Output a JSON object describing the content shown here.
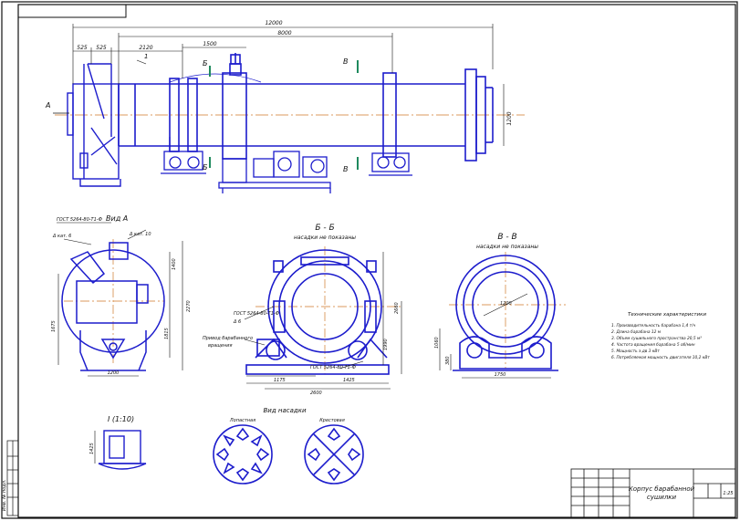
{
  "colors": {
    "blue": "#1c1ccc",
    "black": "#111111",
    "center": "#d07a2a",
    "green": "#1f8a5e"
  },
  "dims_top": {
    "overall": "12000",
    "d1": "8000",
    "d2": "1500",
    "d3": "2120",
    "d4": "525",
    "d5": "525",
    "diam": "1200"
  },
  "section_marks": {
    "a": "А",
    "b1": "Б",
    "b2": "Б",
    "v1": "В",
    "v2": "В",
    "one": "1"
  },
  "view_a": {
    "title": "Вид А",
    "gost": "ГОСТ 5264-80-T1-Ф",
    "weld_left": "Δ кат. 6",
    "weld_right": "Δ кат. 10",
    "h1": "1400",
    "h2": "2270",
    "h3": "1815",
    "w": "1200",
    "left_h": "1675"
  },
  "section_bb": {
    "title": "Б - Б",
    "subtitle": "насадки не показаны",
    "gost1": "ГОСТ 5264-80-T1-Ф",
    "gost2": "ГОСТ 5264-80-T1-Ф",
    "weld": "Δ 6",
    "note1": "Привод барабанного",
    "note2": "вращения",
    "d1": "1175",
    "d2": "1425",
    "d3": "2600",
    "h": "2660",
    "hh": "1990"
  },
  "section_vv": {
    "title": "В - В",
    "subtitle": "насадки не показаны",
    "dia": "1200",
    "w": "1750",
    "h1": "1060",
    "h2": "380"
  },
  "detail_1": {
    "title": "I (1:10)",
    "dim": "1425"
  },
  "nozzles": {
    "title": "Вид насадки",
    "left": "Лопастная",
    "right": "Крестовая"
  },
  "tech": {
    "title": "Технические характеристики",
    "lines": [
      "1. Производительность барабана 1,4 т/ч",
      "2. Длина барабана 12 м",
      "3. Объем сушильного пространства 20,5 м³",
      "4. Частота вращения барабана 5 об/мин",
      "5. Мощность э.дв 3 кВт",
      "6. Потребляемая мощность двигателя 10,2 кВт"
    ]
  },
  "title_block": {
    "name1": "Корпус барабанной",
    "name2": "сушилки",
    "scale": "1:25"
  },
  "stamp_tl": "",
  "side_label": "Инв. № подл."
}
